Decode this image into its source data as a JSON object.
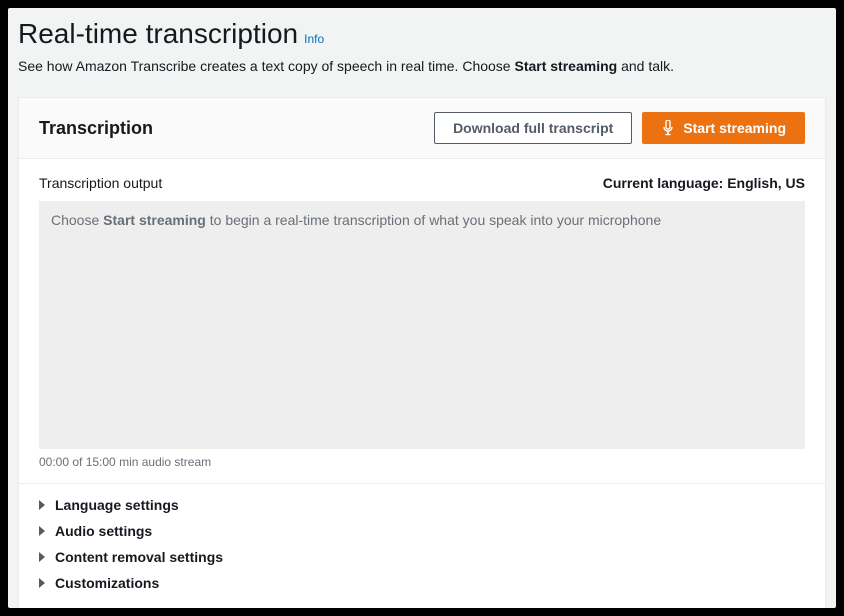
{
  "header": {
    "title": "Real-time transcription",
    "info_label": "Info",
    "description_pre": "See how Amazon Transcribe creates a text copy of speech in real time. Choose ",
    "description_strong": "Start streaming",
    "description_post": " and talk."
  },
  "card": {
    "title": "Transcription",
    "download_label": "Download full transcript",
    "start_label": "Start streaming"
  },
  "output": {
    "label": "Transcription output",
    "current_language_label": "Current language: English, US",
    "placeholder_pre": "Choose ",
    "placeholder_strong": "Start streaming",
    "placeholder_post": " to begin a real-time transcription of what you speak into your microphone",
    "stream_time": "00:00 of 15:00 min audio stream"
  },
  "sections": [
    {
      "label": "Language settings"
    },
    {
      "label": "Audio settings"
    },
    {
      "label": "Content removal settings"
    },
    {
      "label": "Customizations"
    }
  ],
  "colors": {
    "primary": "#ec7211",
    "link": "#0073bb"
  }
}
